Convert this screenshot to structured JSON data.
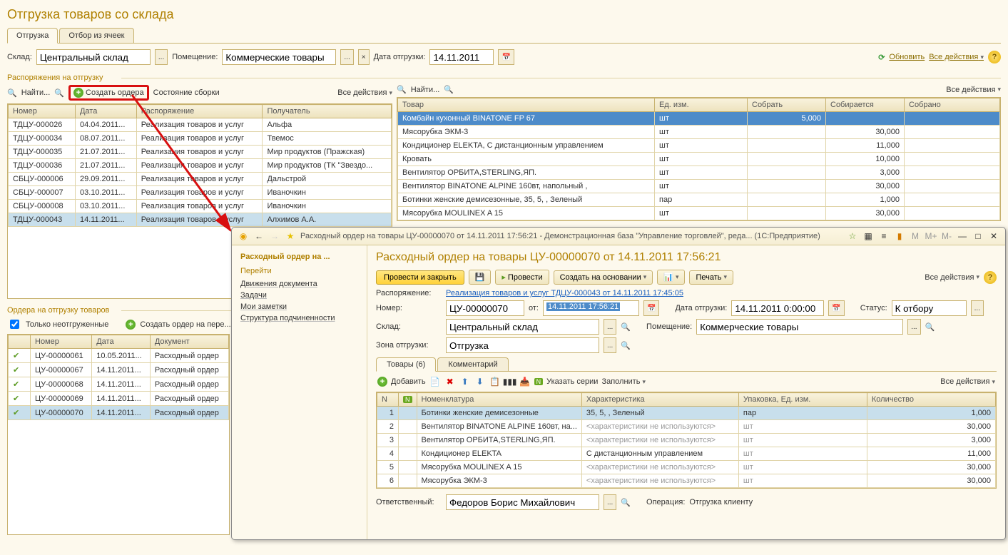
{
  "page_title": "Отгрузка товаров со склада",
  "tabs": [
    "Отгрузка",
    "Отбор из ячеек"
  ],
  "filters": {
    "warehouse_lbl": "Склад:",
    "warehouse": "Центральный склад",
    "room_lbl": "Помещение:",
    "room": "Коммерческие товары",
    "date_lbl": "Дата отгрузки:",
    "date": "14.11.2011",
    "refresh": "Обновить",
    "all_actions": "Все действия"
  },
  "orders_dispatch": {
    "legend": "Распоряжения на отгрузку",
    "find": "Найти...",
    "create_orders": "Создать ордера",
    "assembly_state": "Состояние сборки",
    "all_actions": "Все действия",
    "cols": [
      "Номер",
      "Дата",
      "Распоряжение",
      "Получатель"
    ],
    "rows": [
      [
        "ТДЦУ-000026",
        "04.04.2011...",
        "Реализация товаров и услуг",
        "Альфа"
      ],
      [
        "ТДЦУ-000034",
        "08.07.2011...",
        "Реализация товаров и услуг",
        "Твемос"
      ],
      [
        "ТДЦУ-000035",
        "21.07.2011...",
        "Реализация товаров и услуг",
        "Мир продуктов (Пражская)"
      ],
      [
        "ТДЦУ-000036",
        "21.07.2011...",
        "Реализация товаров и услуг",
        "Мир продуктов (ТК \"Звездо..."
      ],
      [
        "СБЦУ-000006",
        "29.09.2011...",
        "Реализация товаров и услуг",
        "Дальстрой"
      ],
      [
        "СБЦУ-000007",
        "03.10.2011...",
        "Реализация товаров и услуг",
        "Иваночкин"
      ],
      [
        "СБЦУ-000008",
        "03.10.2011...",
        "Реализация товаров и услуг",
        "Иваночкин"
      ],
      [
        "ТДЦУ-000043",
        "14.11.2011...",
        "Реализация товаров и услуг",
        "Алхимов А.А."
      ]
    ],
    "selected_index": 7
  },
  "goods": {
    "find": "Найти...",
    "all_actions": "Все действия",
    "cols": [
      "Товар",
      "Ед. изм.",
      "Собрать",
      "Собирается",
      "Собрано"
    ],
    "rows": [
      [
        "Комбайн кухонный BINATONE FP 67",
        "шт",
        "5,000",
        "",
        ""
      ],
      [
        "Мясорубка ЭКМ-3",
        "шт",
        "",
        "30,000",
        ""
      ],
      [
        "Кондиционер ELEKTA, С дистанционным управлением",
        "шт",
        "",
        "11,000",
        ""
      ],
      [
        "Кровать",
        "шт",
        "",
        "10,000",
        ""
      ],
      [
        "Вентилятор ОРБИТА,STERLING,ЯП.",
        "шт",
        "",
        "3,000",
        ""
      ],
      [
        "Вентилятор BINATONE ALPINE 160вт, напольный ,",
        "шт",
        "",
        "30,000",
        ""
      ],
      [
        "Ботинки женские демисезонные, 35, 5, , Зеленый",
        "пар",
        "",
        "1,000",
        ""
      ],
      [
        "Мясорубка MOULINEX  A 15",
        "шт",
        "",
        "30,000",
        ""
      ]
    ],
    "selected_index": 0
  },
  "ship_orders": {
    "legend": "Ордера на отгрузку товаров",
    "only_unshipped": "Только неотгруженные",
    "create_order": "Создать ордер на пере...",
    "cols": [
      "Номер",
      "Дата",
      "Документ"
    ],
    "rows": [
      [
        "ЦУ-00000061",
        "10.05.2011...",
        "Расходный ордер"
      ],
      [
        "ЦУ-00000067",
        "14.11.2011...",
        "Расходный ордер"
      ],
      [
        "ЦУ-00000068",
        "14.11.2011...",
        "Расходный ордер"
      ],
      [
        "ЦУ-00000069",
        "14.11.2011...",
        "Расходный ордер"
      ],
      [
        "ЦУ-00000070",
        "14.11.2011...",
        "Расходный ордер"
      ]
    ],
    "selected_index": 4
  },
  "dialog": {
    "window_title": "Расходный ордер на товары ЦУ-00000070 от 14.11.2011 17:56:21 - Демонстрационная база \"Управление торговлей\", реда...    (1С:Предприятие)",
    "nav": {
      "head": "Расходный ордер на ...",
      "section": "Перейти",
      "items": [
        "Движения документа",
        "Задачи",
        "Мои заметки",
        "Структура подчиненности"
      ]
    },
    "heading": "Расходный ордер на товары ЦУ-00000070 от 14.11.2011 17:56:21",
    "buttons": {
      "post_close": "Провести и закрыть",
      "post": "Провести",
      "create_based": "Создать на основании",
      "print": "Печать",
      "all_actions": "Все действия"
    },
    "fields": {
      "dispatch_lbl": "Распоряжение:",
      "dispatch_link": "Реализация товаров и услуг ТДЦУ-000043 от 14.11.2011 17:45:05",
      "number_lbl": "Номер:",
      "number": "ЦУ-00000070",
      "from_lbl": "от:",
      "from": "14.11.2011 17:56:21",
      "ship_date_lbl": "Дата отгрузки:",
      "ship_date": "14.11.2011 0:00:00",
      "status_lbl": "Статус:",
      "status": "К отбору",
      "warehouse_lbl": "Склад:",
      "warehouse": "Центральный склад",
      "room_lbl": "Помещение:",
      "room": "Коммерческие товары",
      "zone_lbl": "Зона отгрузки:",
      "zone": "Отгрузка"
    },
    "inner_tabs": [
      "Товары (6)",
      "Комментарий"
    ],
    "items_toolbar": {
      "add": "Добавить",
      "series": "Указать серии",
      "fill": "Заполнить",
      "all_actions": "Все действия"
    },
    "items_cols": [
      "N",
      "",
      "Номенклатура",
      "Характеристика",
      "Упаковка, Ед. изм.",
      "Количество"
    ],
    "items": [
      [
        "1",
        "",
        "Ботинки женские демисезонные",
        "35, 5, , Зеленый",
        "пар",
        "1,000"
      ],
      [
        "2",
        "",
        "Вентилятор BINATONE ALPINE 160вт, на...",
        "<характеристики не используются>",
        "шт",
        "30,000"
      ],
      [
        "3",
        "",
        "Вентилятор ОРБИТА,STERLING,ЯП.",
        "<характеристики не используются>",
        "шт",
        "3,000"
      ],
      [
        "4",
        "",
        "Кондиционер ELEKTA",
        "С дистанционным управлением",
        "шт",
        "11,000"
      ],
      [
        "5",
        "",
        "Мясорубка MOULINEX  A 15",
        "<характеристики не используются>",
        "шт",
        "30,000"
      ],
      [
        "6",
        "",
        "Мясорубка ЭКМ-3",
        "<характеристики не используются>",
        "шт",
        "30,000"
      ]
    ],
    "items_selected": 0,
    "footer": {
      "resp_lbl": "Ответственный:",
      "resp": "Федоров Борис Михайлович",
      "op_lbl": "Операция:",
      "op": "Отгрузка клиенту"
    }
  }
}
